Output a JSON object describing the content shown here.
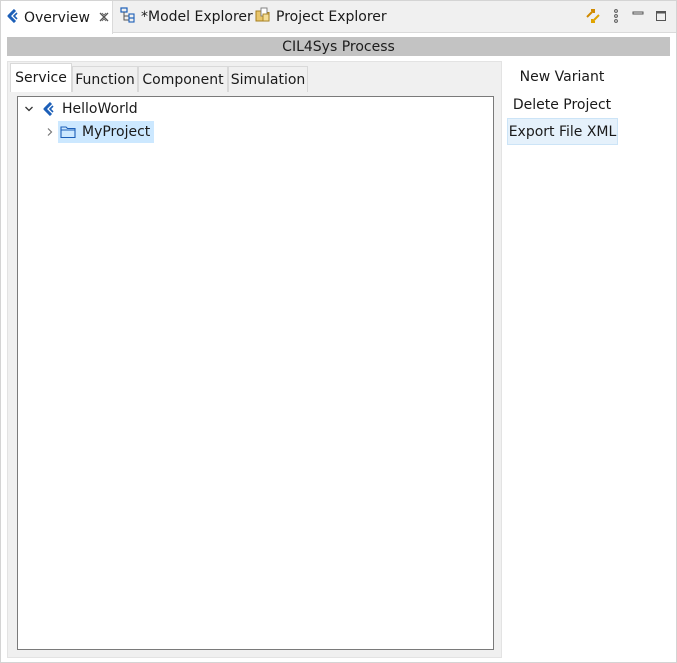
{
  "view_tabs": [
    {
      "label": "Overview",
      "icon": "cil4sys-logo-icon",
      "active": true,
      "closable": true
    },
    {
      "label": "*Model Explorer",
      "icon": "model-explorer-icon",
      "active": false
    },
    {
      "label": "Project Explorer",
      "icon": "project-explorer-icon",
      "active": false
    }
  ],
  "toolbar": {
    "sync_icon": "sync-icon",
    "menu_icon": "view-menu-icon",
    "minimize_icon": "minimize-icon",
    "maximize_icon": "maximize-icon"
  },
  "section": {
    "title": "CIL4Sys Process"
  },
  "inner_tabs": [
    {
      "label": "Service",
      "active": true
    },
    {
      "label": "Function",
      "active": false
    },
    {
      "label": "Component",
      "active": false
    },
    {
      "label": "Simulation",
      "active": false
    }
  ],
  "tree": {
    "root": {
      "label": "HelloWorld",
      "expanded": true,
      "icon": "cil4sys-logo-icon"
    },
    "children": [
      {
        "label": "MyProject",
        "expanded": false,
        "selected": true,
        "icon": "folder-icon"
      }
    ]
  },
  "actions": {
    "new_variant": "New Variant",
    "delete_project": "Delete Project",
    "export_file_xml": "Export File XML"
  },
  "colors": {
    "accent": "#1c5fb8",
    "selection": "#cce8ff",
    "header_bar": "#c3c3c3",
    "tab_strip": "#f0f0f0"
  }
}
